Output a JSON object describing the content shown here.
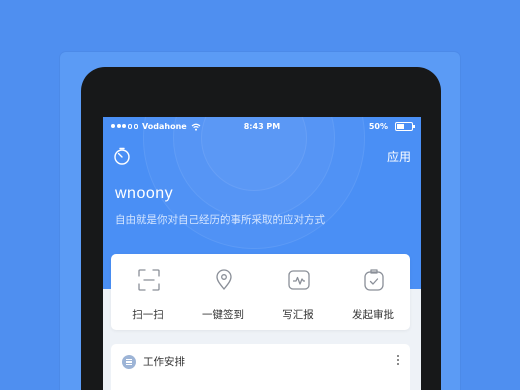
{
  "status_bar": {
    "carrier": "Vodahone",
    "time": "8:43 PM",
    "battery_percent": "50%",
    "battery_level": 0.5,
    "signal_icon": "signal-dots-icon",
    "wifi_icon": "wifi-icon"
  },
  "header": {
    "left_icon": "clock-icon",
    "right_button": "应用"
  },
  "profile": {
    "username": "wnoony",
    "tagline": "自由就是你对自己经历的事所采取的应对方式"
  },
  "quick_actions": [
    {
      "label": "扫一扫",
      "icon": "scan-icon"
    },
    {
      "label": "一键签到",
      "icon": "location-pin-icon"
    },
    {
      "label": "写汇报",
      "icon": "report-icon"
    },
    {
      "label": "发起审批",
      "icon": "approval-icon"
    }
  ],
  "work_section": {
    "title": "工作安排",
    "icon": "list-icon",
    "menu_icon": "more-vertical-icon"
  },
  "colors": {
    "page_background": "#4f8ff0",
    "hero_blue": "#4a8ff5",
    "device_bezel": "#171819",
    "icon_gray": "#8a8f98"
  }
}
